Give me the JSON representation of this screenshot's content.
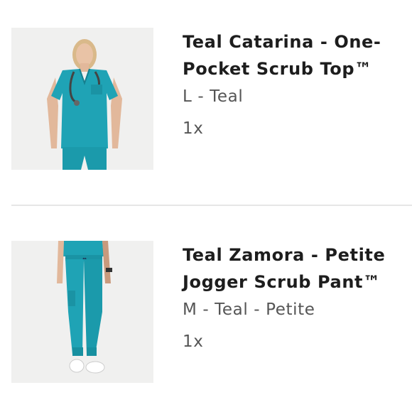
{
  "cart": {
    "items": [
      {
        "title": "Teal Catarina - One-Pocket Scrub Top™",
        "variant": "L - Teal",
        "quantity": "1x",
        "image_icon": "product-photo-scrub-top",
        "color": "#1fa3b5"
      },
      {
        "title": "Teal Zamora - Petite Jogger Scrub Pant™",
        "variant": "M - Teal - Petite",
        "quantity": "1x",
        "image_icon": "product-photo-jogger-pant",
        "color": "#1fa3b5"
      }
    ]
  }
}
